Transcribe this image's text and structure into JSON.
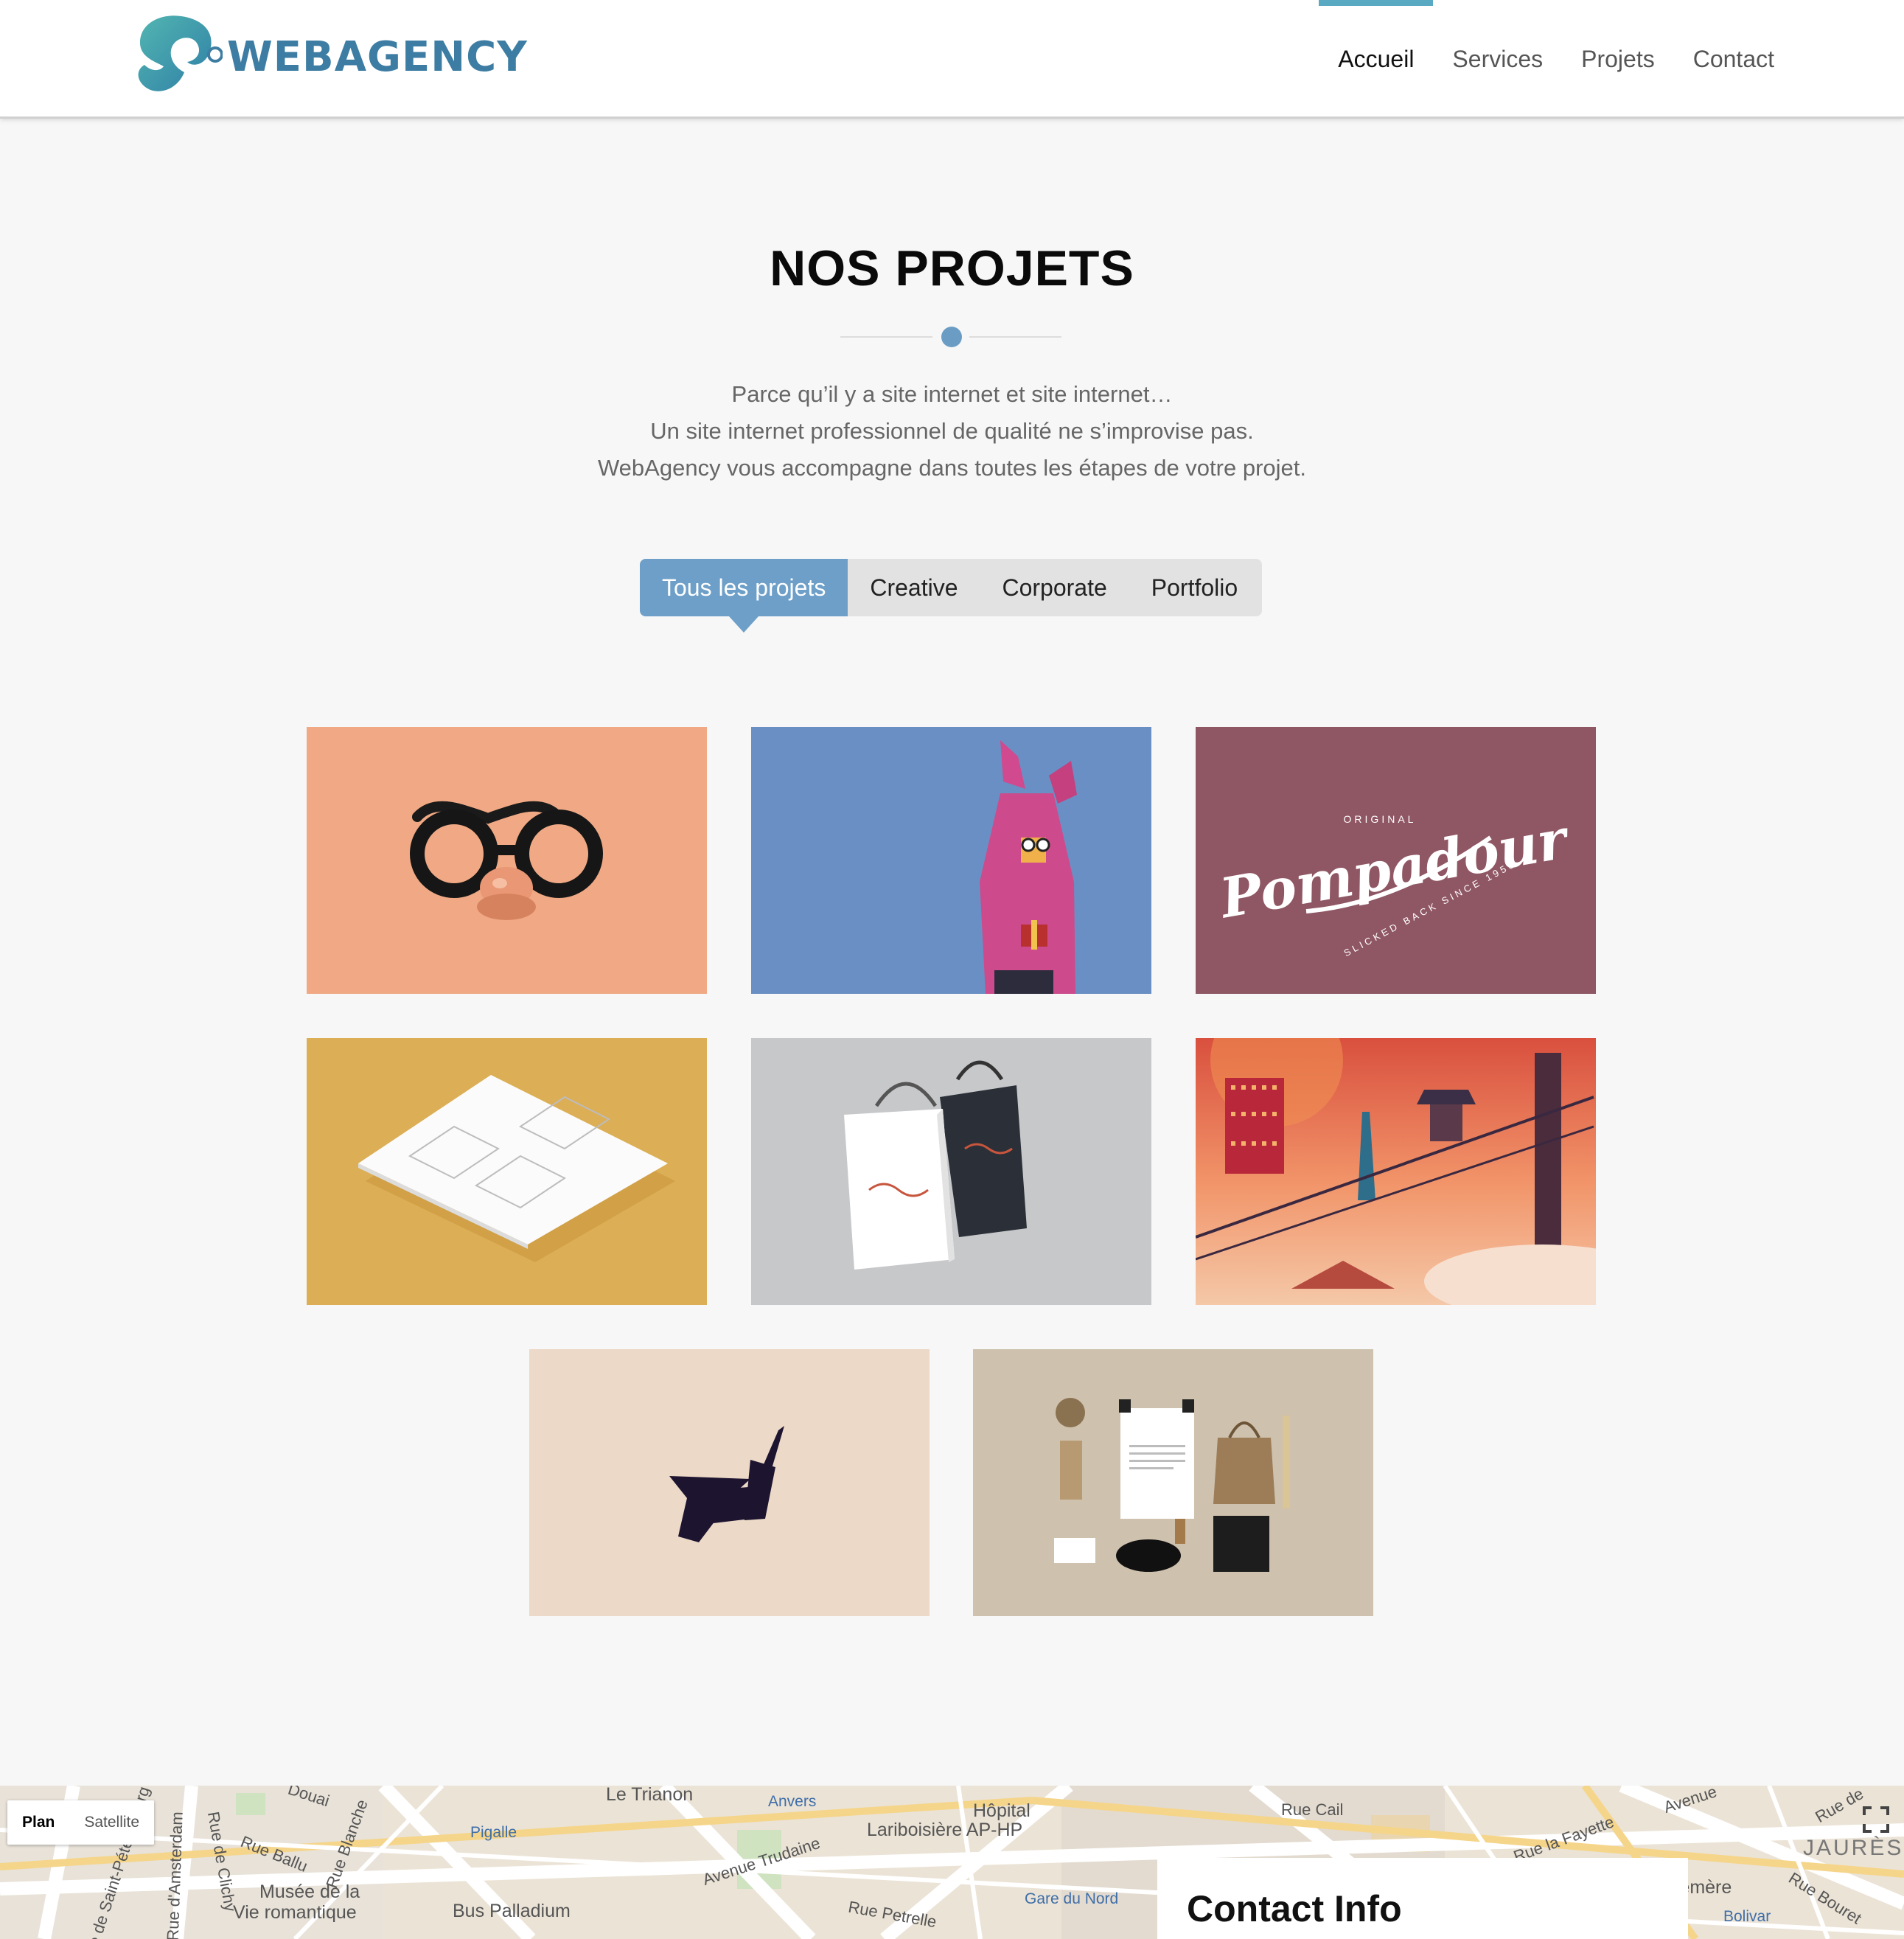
{
  "brand": {
    "name": "WEBAGENCY",
    "color": "#3d7da3"
  },
  "nav": {
    "items": [
      {
        "label": "Accueil",
        "active": true
      },
      {
        "label": "Services"
      },
      {
        "label": "Projets"
      },
      {
        "label": "Contact"
      }
    ],
    "active_color": "#5aa9c2"
  },
  "projects": {
    "title": "NOS PROJETS",
    "intro": [
      "Parce qu’il y a site internet et site internet…",
      "Un site internet professionnel de qualité ne s’improvise pas.",
      "WebAgency vous accompagne dans toutes les étapes de votre projet."
    ],
    "filters": [
      {
        "label": "Tous les projets",
        "active": true
      },
      {
        "label": "Creative"
      },
      {
        "label": "Corporate"
      },
      {
        "label": "Portfolio"
      }
    ],
    "filter_active_color": "#6d9fc8",
    "tiles": [
      {
        "name": "glasses-disguise-illustration",
        "bg": "#f0a984"
      },
      {
        "name": "pink-bunny-costume-illustration",
        "bg": "#6a8fc4"
      },
      {
        "name": "pompadour-logo",
        "bg": "#8f5664",
        "text": {
          "top": "ORIGINAL",
          "script": "Pompadour",
          "arc": "SLICKED BACK SINCE 1950"
        }
      },
      {
        "name": "paper-mockup",
        "bg": "#dcae55"
      },
      {
        "name": "shopping-bags-mockup",
        "bg": "#c7c8ca"
      },
      {
        "name": "city-sunset-illustration",
        "bg": "#e07a55"
      },
      {
        "name": "dart-logo-illustration",
        "bg": "#ecd9c7"
      },
      {
        "name": "stationery-branding-mockup",
        "bg": "#cec1ad"
      }
    ]
  },
  "map": {
    "type_controls": [
      {
        "label": "Plan",
        "active": true
      },
      {
        "label": "Satellite"
      }
    ],
    "labels": [
      "Le Trianon",
      "Anvers",
      "Hôpital",
      "Lariboisière AP-HP",
      "Pigalle",
      "Rue Cail",
      "Avenue Trudaine",
      "Musée de la",
      "Vie romantique",
      "Bus Palladium",
      "Gare du Nord",
      "Rue Petrelle",
      "Rue Ballu",
      "Rue Blanche",
      "Rue de Clichy",
      "Rue d'Amsterdam",
      "Rue de Saint-Pétersbourg",
      "Rue la Fayette",
      "JAURÈS",
      "Rue Bouret",
      "Bolivar",
      "Point Éphémère",
      "Douai",
      "Avenue",
      "Rue de"
    ],
    "contact_title": "Contact Info"
  }
}
